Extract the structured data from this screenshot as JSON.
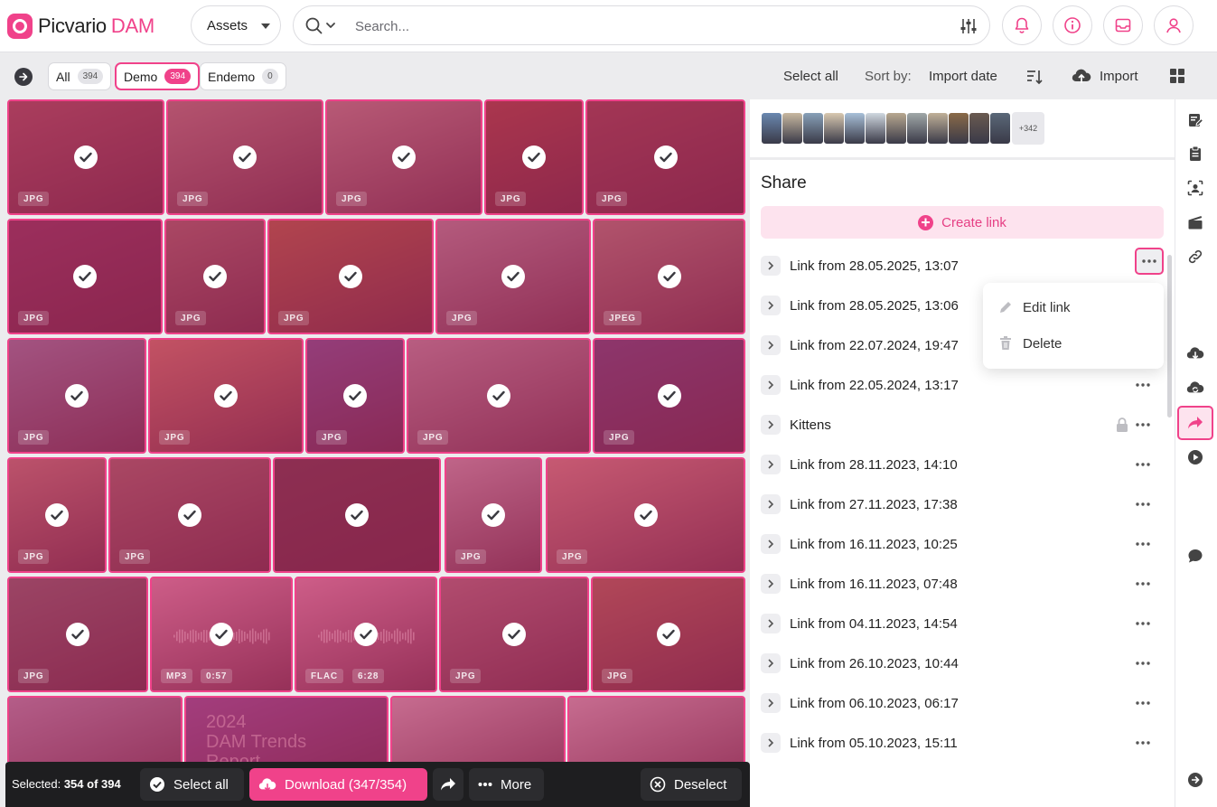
{
  "app": {
    "name": "Picvario",
    "name_suffix": "DAM"
  },
  "header": {
    "assets_select": {
      "value": "Assets"
    },
    "search": {
      "placeholder": "Search..."
    }
  },
  "toolbar": {
    "collections": [
      {
        "label": "All",
        "count": "394"
      },
      {
        "label": "Demo",
        "count": "394"
      },
      {
        "label": "Endemo",
        "count": "0"
      }
    ],
    "select_all": "Select all",
    "sort_label": "Sort by:",
    "sort_value": "Import date",
    "import_label": "Import"
  },
  "grid": {
    "tiles": [
      {
        "format": "JPG",
        "color": "#8a5a5a"
      },
      {
        "format": "JPG",
        "color": "#a08a80"
      },
      {
        "format": "JPG",
        "color": "#a89890"
      },
      {
        "format": "JPG",
        "color": "#8a4a38"
      },
      {
        "format": "JPG",
        "color": "#7a4a48"
      },
      {
        "format": "JPG",
        "color": "#6a3a58"
      },
      {
        "format": "JPG",
        "color": "#8a7068"
      },
      {
        "format": "JPG",
        "color": "#9a6a3a"
      },
      {
        "format": "JPG",
        "color": "#a09aa0"
      },
      {
        "format": "JPEG",
        "color": "#9a8a7a"
      },
      {
        "format": "JPG",
        "color": "#7a8aa8"
      },
      {
        "format": "JPG",
        "color": "#c08868"
      },
      {
        "format": "JPG",
        "color": "#5a5a98"
      },
      {
        "format": "JPG",
        "color": "#a8a0a8"
      },
      {
        "format": "JPG",
        "color": "#4a4a7a"
      },
      {
        "format": "JPG",
        "color": "#b08878"
      },
      {
        "format": "JPG",
        "color": "#8a7068"
      },
      {
        "format": "",
        "color": "#4a3a40"
      },
      {
        "format": "JPG",
        "color": "#b8b0b8"
      },
      {
        "format": "JPG",
        "color": "#c89888"
      },
      {
        "format": "JPG",
        "color": "#6a6a6a"
      },
      {
        "format": "MP3",
        "duration": "0:57",
        "color": "#d8a0b8"
      },
      {
        "format": "FLAC",
        "duration": "6:28",
        "color": "#d8a0b8"
      },
      {
        "format": "JPG",
        "color": "#9a7a80"
      },
      {
        "format": "JPG",
        "color": "#9a7050"
      },
      {
        "format": "",
        "color": "#a0a0b8"
      },
      {
        "format": "",
        "color": "#7a5aa0",
        "art_text": "2024\nDAM Trends\nReport"
      },
      {
        "format": "",
        "color": "#c8c0c8"
      },
      {
        "format": "",
        "color": "#c8c0c8"
      }
    ]
  },
  "selection_bar": {
    "selected_label": "Selected:",
    "selected_value": "354 of 394",
    "select_all": "Select all",
    "download": "Download (347/354)",
    "more": "More",
    "deselect": "Deselect"
  },
  "panel": {
    "more_count": "+342",
    "title": "Share",
    "create_link": "Create link",
    "links": [
      {
        "name": "Link from 28.05.2025, 13:07"
      },
      {
        "name": "Link from 28.05.2025, 13:06"
      },
      {
        "name": "Link from 22.07.2024, 19:47"
      },
      {
        "name": "Link from 22.05.2024, 13:17"
      },
      {
        "name": "Kittens",
        "locked": true
      },
      {
        "name": "Link from 28.11.2023, 14:10"
      },
      {
        "name": "Link from 27.11.2023, 17:38"
      },
      {
        "name": "Link from 16.11.2023, 10:25"
      },
      {
        "name": "Link from 16.11.2023, 07:48"
      },
      {
        "name": "Link from 04.11.2023, 14:54"
      },
      {
        "name": "Link from 26.10.2023, 10:44"
      },
      {
        "name": "Link from 06.10.2023, 06:17"
      },
      {
        "name": "Link from 05.10.2023, 15:11"
      }
    ],
    "context_menu": {
      "edit": "Edit link",
      "delete": "Delete"
    }
  },
  "colors": {
    "accent": "#f0428a",
    "accent_light": "#fde3ee",
    "dark_bar": "#1e1e20"
  },
  "icons": {
    "rail": [
      "edit-metadata-icon",
      "clipboard-icon",
      "face-scan-icon",
      "clapperboard-icon",
      "link-icon",
      "cloud-download-icon",
      "cloud-sync-icon",
      "share-icon",
      "play-icon",
      "comment-icon",
      "expand-arrow-icon"
    ]
  }
}
